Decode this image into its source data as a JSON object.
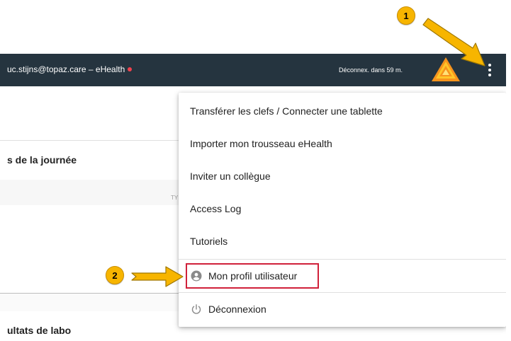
{
  "topbar": {
    "user_label": "uc.stijns@topaz.care – eHealth",
    "session_timeout": "Déconnex. dans 59 m.",
    "logo_icon": "topaz-triangle-logo-icon",
    "menu_icon": "more-vertical-icon",
    "status_color": "#f0424e"
  },
  "background": {
    "day_section_title": "s de la journée",
    "type_column_fragment": "TY",
    "lab_section_title": "ultats de labo"
  },
  "menu": {
    "items": [
      {
        "label": "Transférer les clefs / Connecter une tablette"
      },
      {
        "label": "Importer mon trousseau eHealth"
      },
      {
        "label": "Inviter un collègue"
      },
      {
        "label": "Access Log"
      },
      {
        "label": "Tutoriels"
      },
      {
        "label": "Mon profil utilisateur",
        "icon": "account-circle-icon"
      },
      {
        "label": "Déconnexion",
        "icon": "power-icon"
      }
    ]
  },
  "annotations": {
    "step1": "1",
    "step2": "2",
    "highlight_color": "#d0213a",
    "badge_color": "#f7b500"
  }
}
